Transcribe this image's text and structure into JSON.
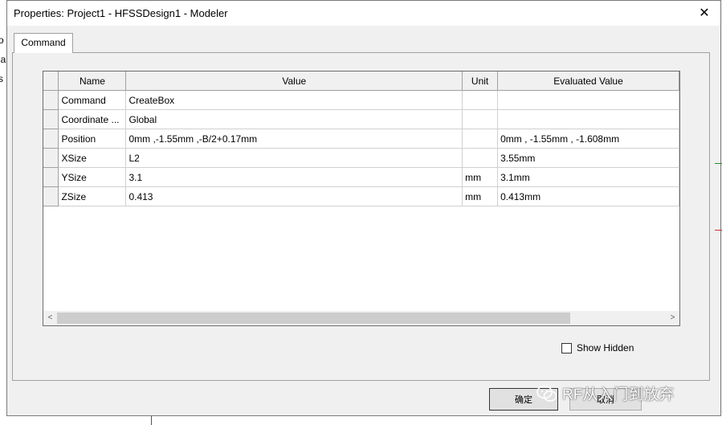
{
  "window": {
    "title": "Properties: Project1 - HFSSDesign1 - Modeler",
    "close_glyph": "✕"
  },
  "background": {
    "letters": [
      "o",
      "la",
      "s"
    ]
  },
  "tabs": [
    {
      "label": "Command"
    }
  ],
  "grid": {
    "columns": [
      "Name",
      "Value",
      "Unit",
      "Evaluated Value"
    ],
    "rows": [
      {
        "name": "Command",
        "value": "CreateBox",
        "unit": "",
        "evaluated": ""
      },
      {
        "name": "Coordinate ...",
        "value": "Global",
        "unit": "",
        "evaluated": ""
      },
      {
        "name": "Position",
        "value": "0mm ,-1.55mm ,-B/2+0.17mm",
        "unit": "",
        "evaluated": "0mm , -1.55mm , -1.608mm"
      },
      {
        "name": "XSize",
        "value": "L2",
        "unit": "",
        "evaluated": "3.55mm"
      },
      {
        "name": "YSize",
        "value": "3.1",
        "unit": "mm",
        "evaluated": "3.1mm"
      },
      {
        "name": "ZSize",
        "value": "0.413",
        "unit": "mm",
        "evaluated": "0.413mm"
      }
    ]
  },
  "scrollbar": {
    "left_arrow": "<",
    "right_arrow": ">"
  },
  "show_hidden": {
    "label": "Show Hidden",
    "checked": false
  },
  "buttons": {
    "ok": "确定",
    "cancel": "取消"
  },
  "watermark": {
    "text": "RF从入门到放弃"
  }
}
